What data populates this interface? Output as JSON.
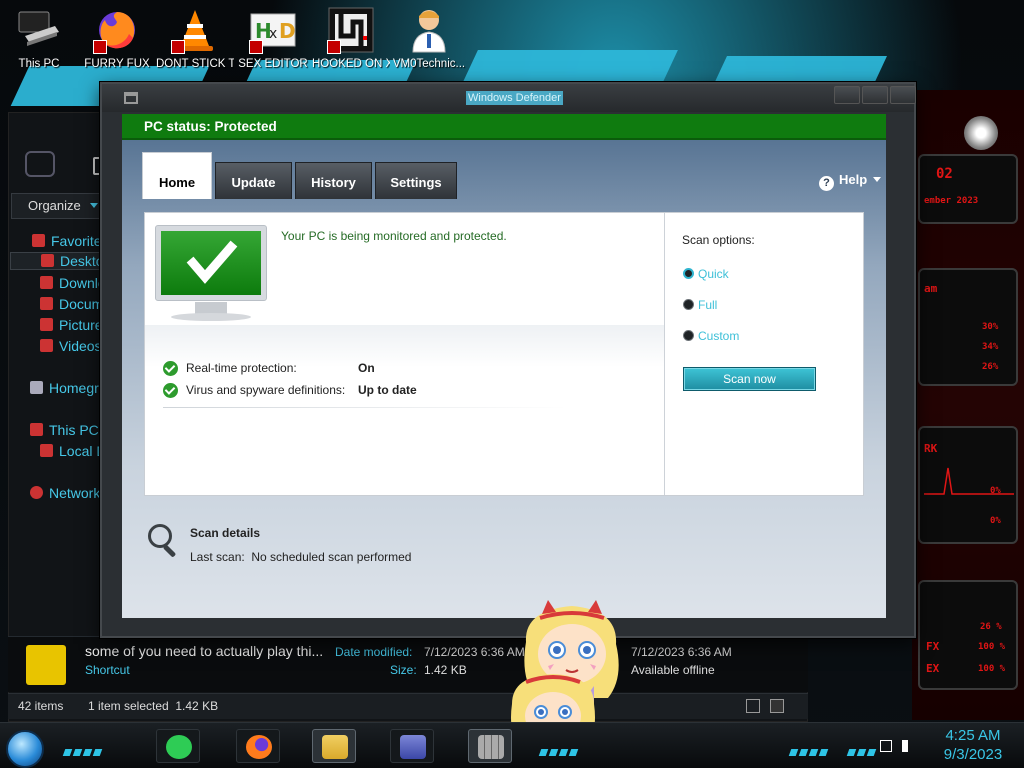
{
  "desktop_icons": [
    {
      "label": "This PC",
      "icon": "this-pc-icon"
    },
    {
      "label": "FURRY FUX",
      "icon": "firefox-icon"
    },
    {
      "label": "DONT STICK THIS IN YO...",
      "icon": "vlc-icon"
    },
    {
      "label": "SEX EDITOR",
      "icon": "hxd-icon"
    },
    {
      "label": "HOOKED ON XONIX",
      "icon": "game-icon"
    },
    {
      "label": "VM0Technic...",
      "icon": "technician-icon"
    }
  ],
  "defender": {
    "window_title": "Windows Defender",
    "status": "PC status: Protected",
    "tabs": [
      {
        "label": "Home",
        "active": true
      },
      {
        "label": "Update",
        "active": false
      },
      {
        "label": "History",
        "active": false
      },
      {
        "label": "Settings",
        "active": false
      }
    ],
    "help_label": "Help",
    "message": "Your PC is being monitored and protected.",
    "protection": [
      {
        "label": "Real-time protection:",
        "value": "On"
      },
      {
        "label": "Virus and spyware definitions:",
        "value": "Up to date"
      }
    ],
    "scan_options_title": "Scan options:",
    "scan_options": [
      {
        "label": "Quick",
        "selected": true
      },
      {
        "label": "Full",
        "selected": false
      },
      {
        "label": "Custom",
        "selected": false
      }
    ],
    "scan_button": "Scan now",
    "scan_details_title": "Scan details",
    "last_scan_label": "Last scan:",
    "last_scan_value": "No scheduled scan performed"
  },
  "explorer": {
    "organize_label": "Organize",
    "nav": {
      "favorites": "Favorites",
      "desktop": "Desktop",
      "downloads": "Downloads",
      "documents": "Documents",
      "pictures": "Pictures",
      "videos": "Videos",
      "homegroup": "Homegroup",
      "this_pc": "This PC",
      "local_disk": "Local Disk",
      "network": "Network"
    },
    "details": {
      "name": "some of you need to actually play thi...",
      "type": "Shortcut",
      "date_modified_label": "Date modified:",
      "date_modified": "7/12/2023 6:36 AM",
      "size_label": "Size:",
      "size": "1.42 KB",
      "date_created": "7/12/2023 6:36 AM",
      "availability": "Available offline"
    },
    "status": {
      "items": "42 items",
      "selected": "1 item selected  1.42 KB"
    }
  },
  "alienware_panel": {
    "lines": [
      "02",
      "ember 2023",
      "am",
      "30%",
      "34%",
      "26%",
      "RK",
      "0%",
      "0%",
      "26 %",
      "FX",
      "100 %",
      "EX",
      "100 %"
    ]
  },
  "taskbar": {
    "time": "4:25 AM",
    "date": "9/3/2023",
    "apps": [
      "notes-app-icon",
      "firefox-icon",
      "file-explorer-icon",
      "control-panel-icon",
      "windows-defender-icon"
    ]
  },
  "colors": {
    "status_green": "#0f7b0f",
    "accent_cyan": "#2fb4cf",
    "alien_red": "#e01515"
  }
}
